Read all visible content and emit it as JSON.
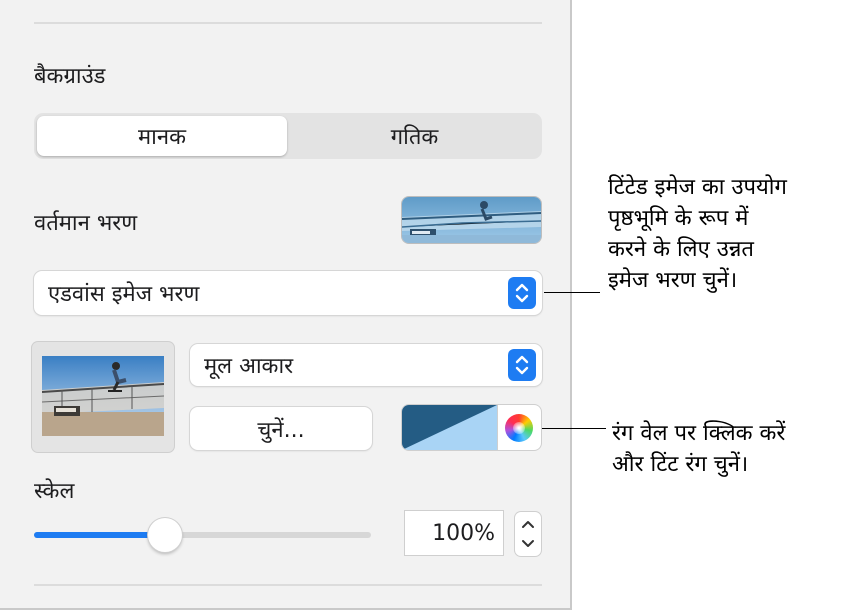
{
  "panel": {
    "background_section_title": "बैकग्राउंड",
    "fill_type_tabs": [
      {
        "label": "मानक",
        "selected": true
      },
      {
        "label": "गतिक",
        "selected": false
      }
    ],
    "current_fill_label": "वर्तमान भरण",
    "fill_type_popup_value": "एडवांस इमेज भरण",
    "image_size_popup_value": "मूल आकार",
    "choose_button_label": "चुनें...",
    "scale_label": "स्केल",
    "scale_value_text": "100%",
    "scale_slider_fraction": 0.39
  },
  "callouts": {
    "fill_callout": [
      "टिंटेड इमेज का उपयोग",
      "पृष्ठभूमि के रूप में",
      "करने के लिए उन्नत",
      "इमेज भरण चुनें।"
    ],
    "color_callout": [
      "रंग वेल पर क्लिक करें",
      "और टिंट रंग चुनें।"
    ]
  },
  "colors": {
    "accent_blue": "#1e7cf2",
    "tint_dark": "#245c84",
    "tint_light": "#a9d4f5",
    "panel_bg": "#f2f2f2"
  },
  "icons": [
    "popup-chevrons-icon",
    "color-wheel-icon",
    "stepper-up-icon",
    "stepper-down-icon"
  ]
}
